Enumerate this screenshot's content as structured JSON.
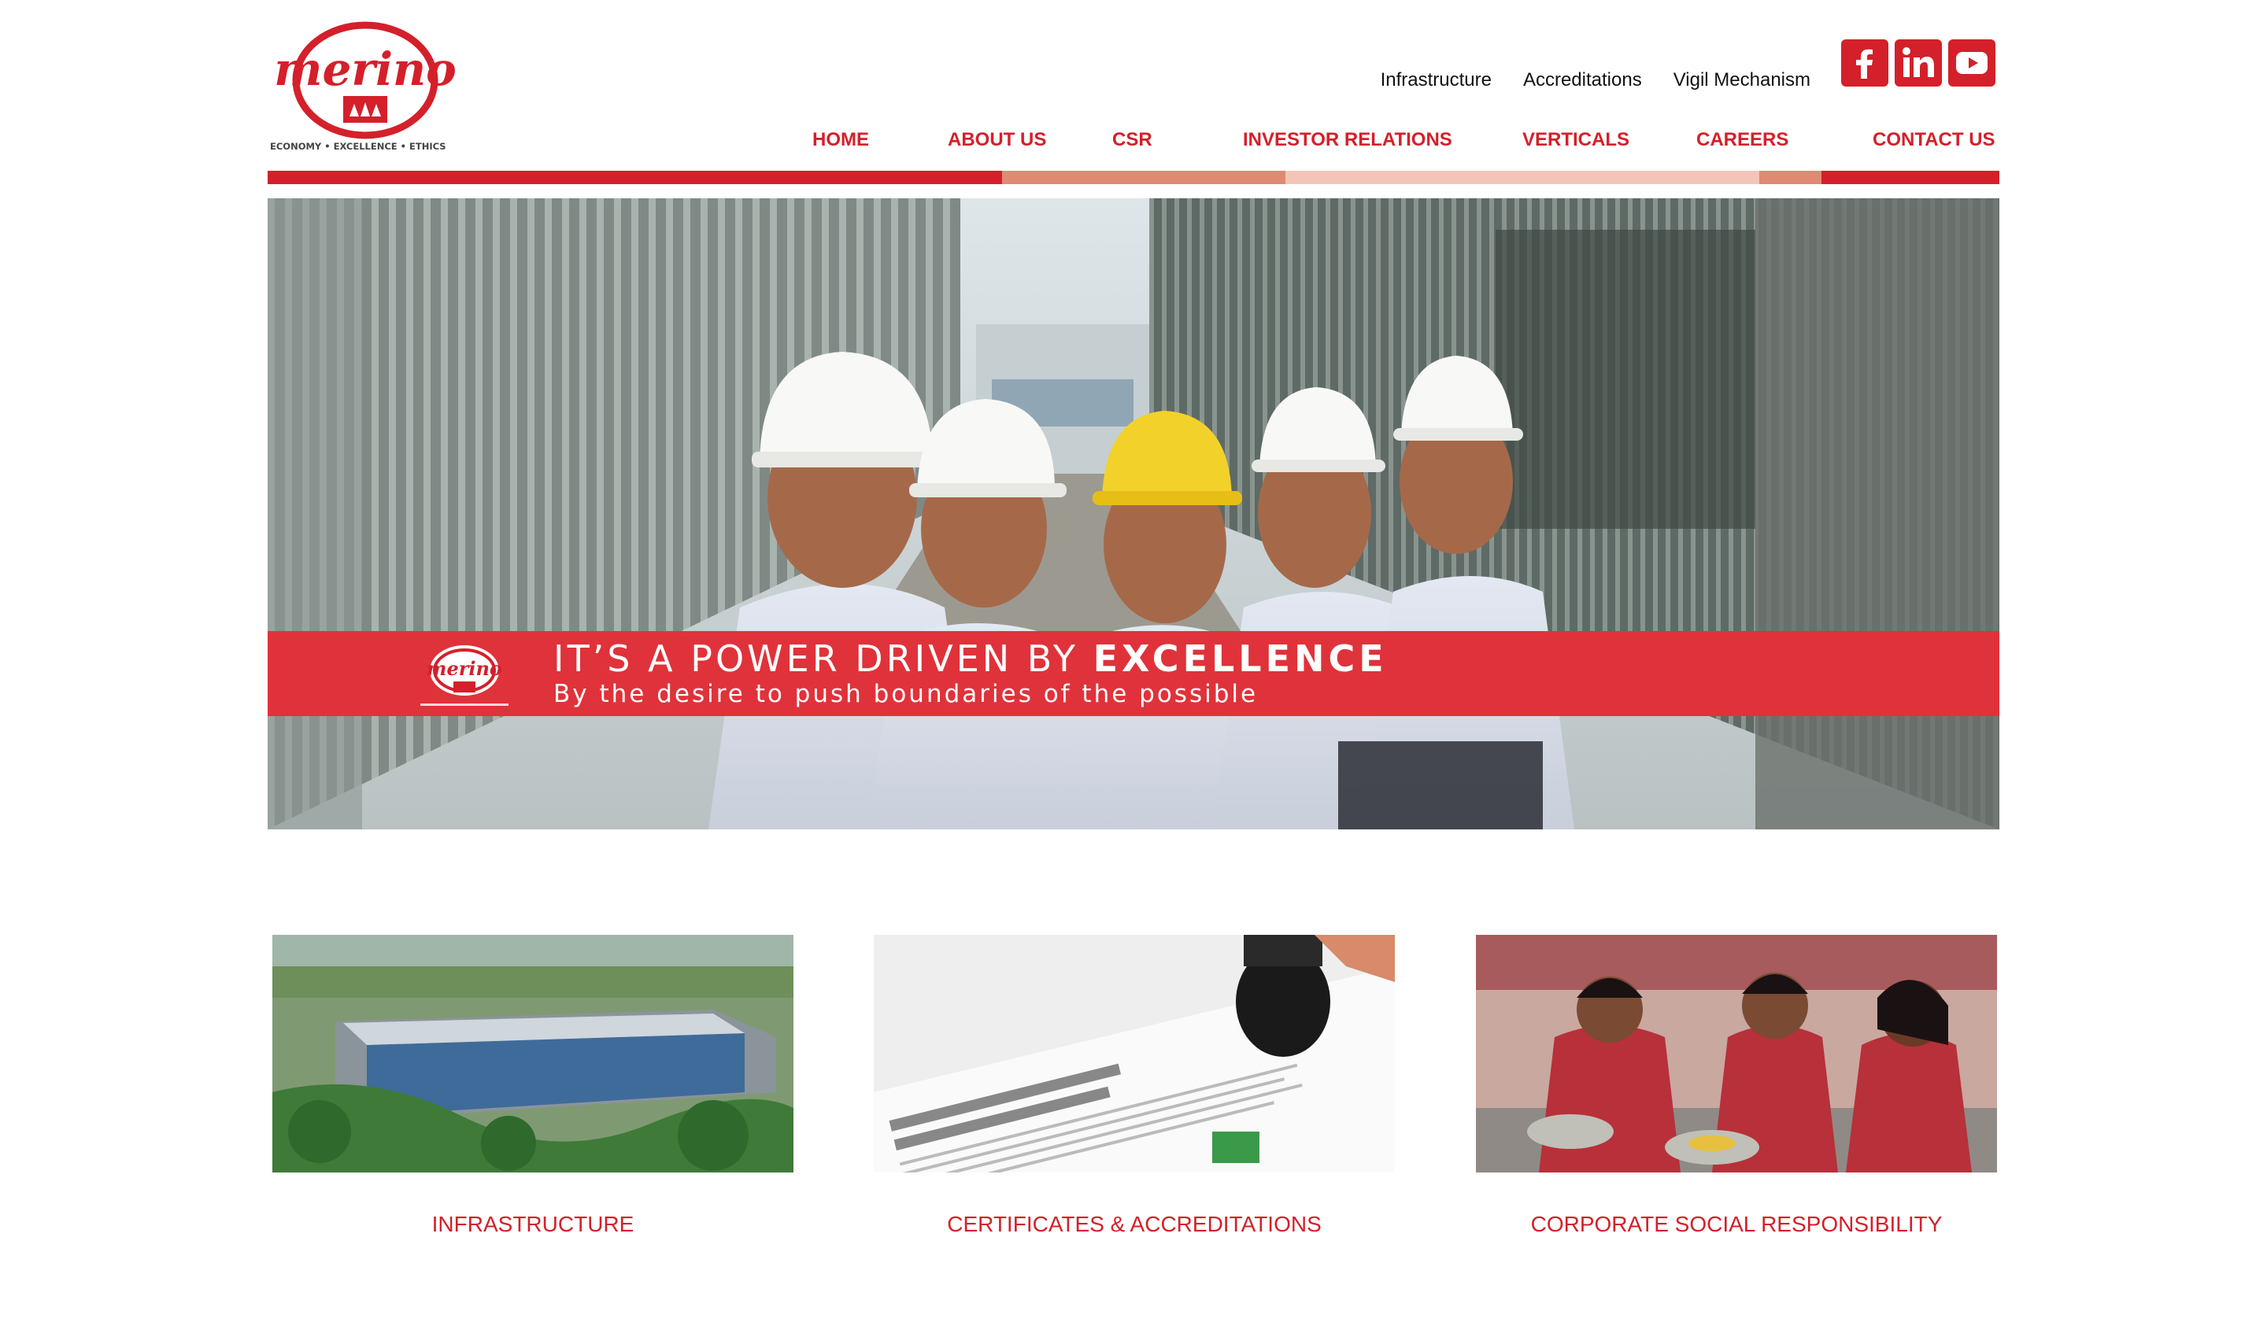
{
  "brand": {
    "name": "merino",
    "tagline": "ECONOMY • EXCELLENCE • ETHICS",
    "color": "#d4202a"
  },
  "utility_links": [
    "Infrastructure",
    "Accreditations",
    "Vigil Mechanism"
  ],
  "social": [
    {
      "name": "facebook",
      "icon": "facebook-icon"
    },
    {
      "name": "linkedin",
      "icon": "linkedin-icon"
    },
    {
      "name": "youtube",
      "icon": "youtube-icon"
    }
  ],
  "nav": [
    "HOME",
    "ABOUT US",
    "CSR",
    "INVESTOR RELATIONS",
    "VERTICALS",
    "CAREERS",
    "CONTACT US"
  ],
  "color_bar": [
    "#d4202a",
    "#e08a74",
    "#f5c4b8",
    "#e08a74",
    "#d4202a"
  ],
  "hero": {
    "title_prefix": "IT’S A POWER DRIVEN BY ",
    "title_emphasis": "EXCELLENCE",
    "subtitle": "By the desire to push boundaries of the possible",
    "band_color": "#e0323a"
  },
  "cards": [
    {
      "caption": "INFRASTRUCTURE"
    },
    {
      "caption": "CERTIFICATES & ACCREDITATIONS"
    },
    {
      "caption": "CORPORATE SOCIAL RESPONSIBILITY"
    }
  ]
}
